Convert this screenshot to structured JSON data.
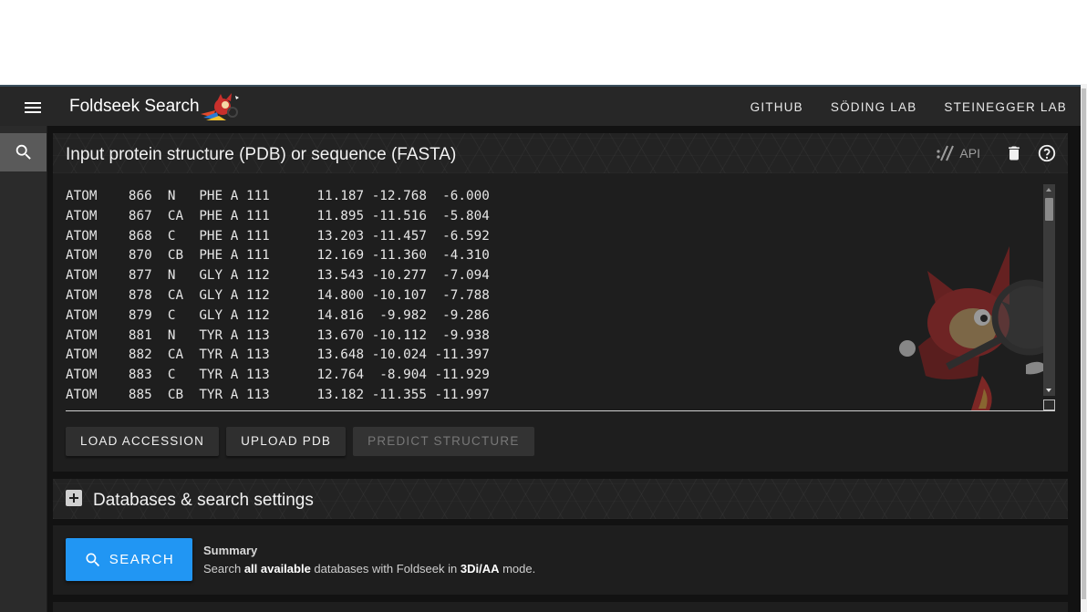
{
  "app": {
    "title": "Foldseek Search",
    "nav": [
      "GITHUB",
      "SÖDING LAB",
      "STEINEGGER LAB"
    ]
  },
  "input_card": {
    "title": "Input protein structure (PDB) or sequence (FASTA)",
    "api_label": "API",
    "pdb_lines": [
      "ATOM    866  N   PHE A 111      11.187 -12.768  -6.000",
      "ATOM    867  CA  PHE A 111      11.895 -11.516  -5.804",
      "ATOM    868  C   PHE A 111      13.203 -11.457  -6.592",
      "ATOM    870  CB  PHE A 111      12.169 -11.360  -4.310",
      "ATOM    877  N   GLY A 112      13.543 -10.277  -7.094",
      "ATOM    878  CA  GLY A 112      14.800 -10.107  -7.788",
      "ATOM    879  C   GLY A 112      14.816  -9.982  -9.286",
      "ATOM    881  N   TYR A 113      13.670 -10.112  -9.938",
      "ATOM    882  CA  TYR A 113      13.648 -10.024 -11.397",
      "ATOM    883  C   TYR A 113      12.764  -8.904 -11.929",
      "ATOM    885  CB  TYR A 113      13.182 -11.355 -11.997"
    ],
    "buttons": {
      "load_accession": "LOAD ACCESSION",
      "upload_pdb": "UPLOAD PDB",
      "predict_structure": "PREDICT STRUCTURE"
    }
  },
  "databases_card": {
    "title": "Databases & search settings"
  },
  "search_card": {
    "button_label": "SEARCH",
    "summary_title": "Summary",
    "summary_prefix": "Search ",
    "summary_all": "all available",
    "summary_middle": " databases with Foldseek in ",
    "summary_mode": "3Di/AA",
    "summary_suffix": " mode."
  },
  "colors": {
    "appbar": "#272727",
    "background": "#121212",
    "card": "#1e1e1e",
    "primary_button": "#2196f3"
  },
  "icons": [
    "menu-icon",
    "search-icon",
    "api-icon",
    "trash-icon",
    "help-circle-icon",
    "plus-box-icon",
    "foldseek-logo",
    "mascot"
  ]
}
